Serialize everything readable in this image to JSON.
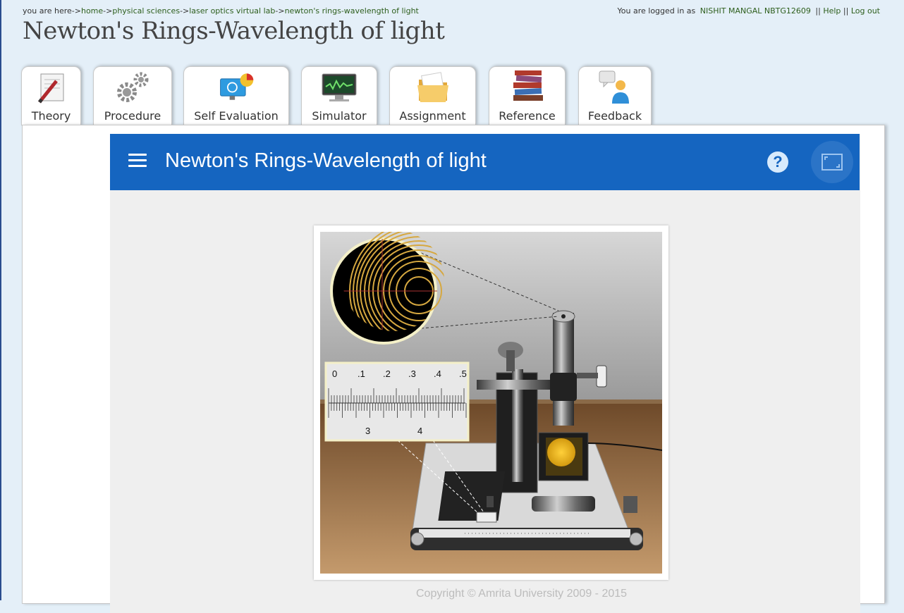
{
  "breadcrumb": {
    "prefix": "you are here->",
    "items": [
      "home",
      "physical sciences",
      "laser optics virtual lab",
      "newton's rings-wavelength of light"
    ],
    "sep": "->"
  },
  "login": {
    "prefix": "You are logged in as",
    "user": "NISHIT MANGAL NBTG12609",
    "sep": "||",
    "help": "Help",
    "logout": "Log out"
  },
  "page_title": "Newton's Rings-Wavelength of light",
  "tabs": [
    {
      "label": "Theory",
      "icon": "theory-icon"
    },
    {
      "label": "Procedure",
      "icon": "gears-icon"
    },
    {
      "label": "Self Evaluation",
      "icon": "self-evaluation-icon"
    },
    {
      "label": "Simulator",
      "icon": "monitor-icon"
    },
    {
      "label": "Assignment",
      "icon": "folder-icon"
    },
    {
      "label": "Reference",
      "icon": "books-icon"
    },
    {
      "label": "Feedback",
      "icon": "feedback-icon"
    }
  ],
  "active_tab": "Simulator",
  "simulator": {
    "title": "Newton's Rings-Wavelength of light",
    "help_symbol": "?",
    "scale": {
      "top_labels": [
        "0",
        ".1",
        ".2",
        ".3",
        ".4",
        ".5"
      ],
      "bottom_labels": [
        "3",
        "4"
      ]
    },
    "copyright": "Copyright © Amrita University 2009 - 2015"
  },
  "colors": {
    "appbar": "#1565c0",
    "page_bg": "#e4eff8",
    "link": "#2d5e1c"
  }
}
